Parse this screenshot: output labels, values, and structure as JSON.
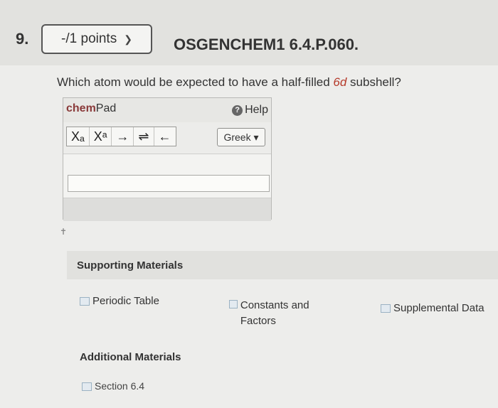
{
  "question": {
    "number": "9.",
    "points": "-/1 points",
    "id": "OSGENCHEM1 6.4.P.060.",
    "text_before": "Which atom would be expected to have a half-filled ",
    "highlight": "6d",
    "text_after": " subshell?"
  },
  "chempad": {
    "title_bold": "chem",
    "title_rest": "Pad",
    "help_label": "Help",
    "tools": [
      "Xₐ",
      "Xᵃ",
      "→",
      "⇌",
      "←"
    ],
    "greek_label": "Greek ▾",
    "input_value": ""
  },
  "supporting": {
    "heading": "Supporting Materials",
    "links": [
      "Periodic Table",
      "Constants and Factors",
      "Supplemental Data"
    ]
  },
  "additional": {
    "heading": "Additional Materials",
    "section": "Section 6.4"
  },
  "colors": {
    "highlight": "#b53a2a",
    "chem_brand": "#8a3a3a"
  },
  "icons": {
    "points_dropdown": "chevron-down-icon",
    "help": "help-circle-icon",
    "links": "book-icon"
  }
}
